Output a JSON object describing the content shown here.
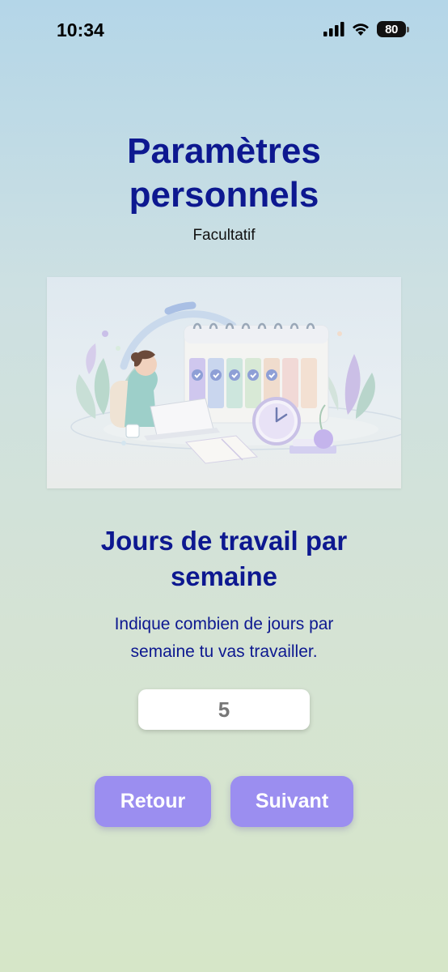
{
  "status_bar": {
    "time": "10:34",
    "battery_level": "80",
    "icons": [
      "signal-icon",
      "wifi-icon",
      "battery-icon"
    ]
  },
  "header": {
    "title_line1": "Paramètres",
    "title_line2": "personnels",
    "subtitle": "Facultatif"
  },
  "illustration": {
    "icon": "calendar-workspace-illustration"
  },
  "section": {
    "title_line1": "Jours de travail par",
    "title_line2": "semaine",
    "description_line1": "Indique combien de jours par",
    "description_line2": "semaine tu vas travailler."
  },
  "days_input": {
    "value": "5"
  },
  "buttons": {
    "back_label": "Retour",
    "next_label": "Suivant"
  },
  "colors": {
    "title": "#0d1890",
    "button": "#9b8ef0",
    "background_top": "#b4d6e8",
    "background_bottom": "#d6e6c8"
  }
}
